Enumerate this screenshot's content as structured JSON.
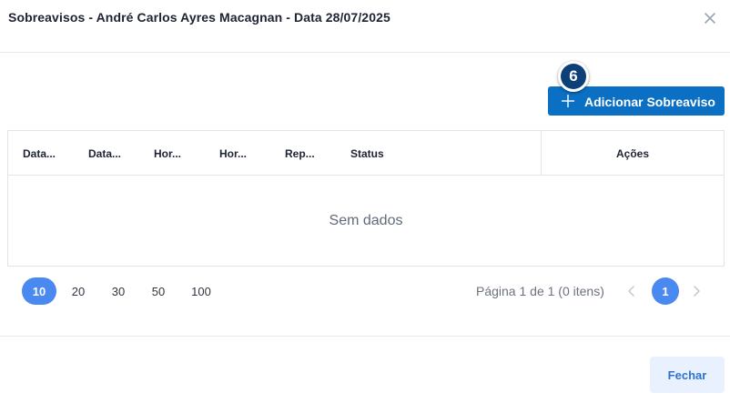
{
  "dialog": {
    "title": "Sobreavisos - André Carlos Ayres Macagnan - Data 28/07/2025",
    "close_icon": "close-icon"
  },
  "toolbar": {
    "add_label": "Adicionar Sobreaviso",
    "add_icon": "plus-icon",
    "step_badge": "6"
  },
  "grid": {
    "columns": [
      "Data...",
      "Data...",
      "Hor...",
      "Hor...",
      "Rep...",
      "Status"
    ],
    "actions_header": "Ações",
    "empty_text": "Sem dados"
  },
  "pager": {
    "page_sizes": [
      "10",
      "20",
      "30",
      "50",
      "100"
    ],
    "selected_page_size": "10",
    "info": "Página 1 de 1 (0 itens)",
    "current_page": "1",
    "prev_icon": "chevron-left-icon",
    "next_icon": "chevron-right-icon"
  },
  "footer": {
    "close_label": "Fechar"
  },
  "colors": {
    "primary": "#0b6fc3",
    "page_active": "#4a89f0",
    "badge": "#0d3f78",
    "secondary_bg": "#e8f1fd"
  }
}
